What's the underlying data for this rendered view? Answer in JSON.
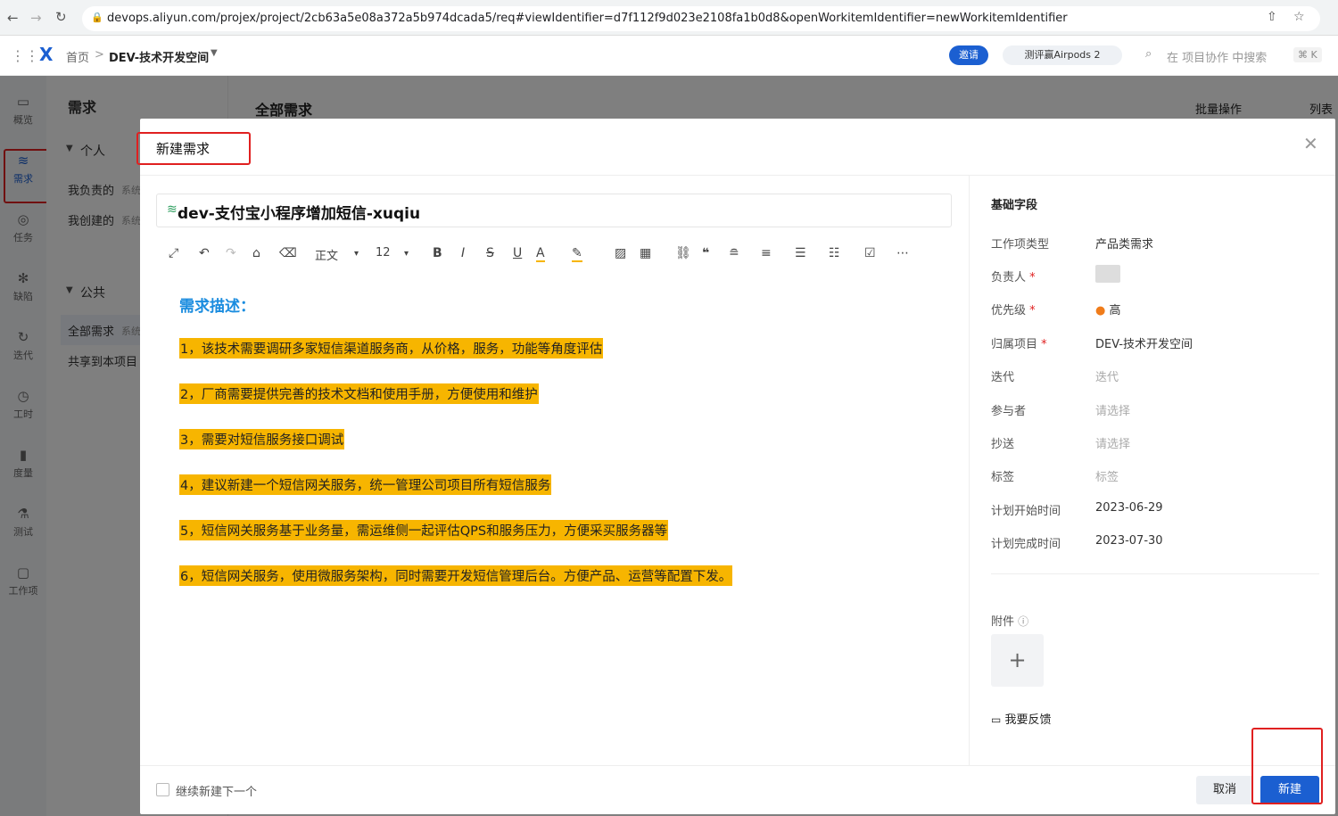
{
  "browser": {
    "url": "devops.aliyun.com/projex/project/2cb63a5e08a372a5b974dcada5/req#viewIdentifier=d7f112f9d023e2108fa1b0d8&openWorkitemIdentifier=newWorkitemIdentifier"
  },
  "topnav": {
    "home": "首页",
    "breadcrumb_sep": ">",
    "space": "DEV-技术开发空间",
    "invite": "邀请",
    "promo": "测评赢Airpods 2",
    "search_placeholder": "在 项目协作 中搜索",
    "shortcut": "⌘ K"
  },
  "rail": [
    {
      "icon": "▭",
      "label": "概览"
    },
    {
      "icon": "≋",
      "label": "需求"
    },
    {
      "icon": "◎",
      "label": "任务"
    },
    {
      "icon": "✻",
      "label": "缺陷"
    },
    {
      "icon": "↻",
      "label": "迭代"
    },
    {
      "icon": "◷",
      "label": "工时"
    },
    {
      "icon": "▮",
      "label": "度量"
    },
    {
      "icon": "⚗",
      "label": "测试"
    },
    {
      "icon": "▢",
      "label": "工作项"
    }
  ],
  "subnav": {
    "title": "需求",
    "personal": "个人",
    "mine": "我负责的",
    "created": "我创建的",
    "sys_tag": "系统",
    "public": "公共",
    "all": "全部需求",
    "shared": "共享到本项目"
  },
  "main": {
    "title": "全部需求",
    "batch": "批量操作",
    "list": "列表"
  },
  "modal": {
    "title": "新建需求",
    "item_title": "dev-支付宝小程序增加短信-xuqiu",
    "toolbar": {
      "style": "正文",
      "size": "12"
    },
    "desc_title": "需求描述：",
    "paragraphs": [
      "1，该技术需要调研多家短信渠道服务商，从价格，服务，功能等角度评估",
      "2，厂商需要提供完善的技术文档和使用手册，方便使用和维护",
      "3，需要对短信服务接口调试",
      "4，建议新建一个短信网关服务，统一管理公司项目所有短信服务",
      "5，短信网关服务基于业务量，需运维侧一起评估QPS和服务压力，方便采买服务器等",
      "6，短信网关服务，使用微服务架构，同时需要开发短信管理后台。方便产品、运营等配置下发。"
    ],
    "panel": {
      "section": "基础字段",
      "fields": [
        {
          "label": "工作项类型",
          "value": "产品类需求",
          "req": ""
        },
        {
          "label": "负责人",
          "value": "",
          "req": "*"
        },
        {
          "label": "优先级",
          "value": "高",
          "req": "*"
        },
        {
          "label": "归属项目",
          "value": "DEV-技术开发空间",
          "req": "*"
        },
        {
          "label": "迭代",
          "value": "迭代",
          "req": ""
        },
        {
          "label": "参与者",
          "value": "请选择",
          "req": ""
        },
        {
          "label": "抄送",
          "value": "请选择",
          "req": ""
        },
        {
          "label": "标签",
          "value": "标签",
          "req": ""
        },
        {
          "label": "计划开始时间",
          "value": "2023-06-29",
          "req": ""
        },
        {
          "label": "计划完成时间",
          "value": "2023-07-30",
          "req": ""
        }
      ],
      "attachment": "附件",
      "feedback": "我要反馈"
    },
    "footer": {
      "continue": "继续新建下一个",
      "cancel": "取消",
      "create": "新建"
    }
  },
  "colors": {
    "highlight": "#f7b500",
    "primary": "#1b5fd1",
    "annotation": "#e02020"
  }
}
